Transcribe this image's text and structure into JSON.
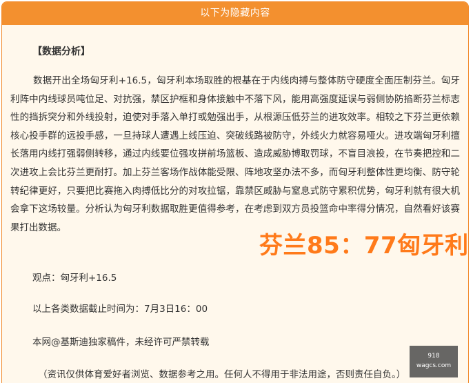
{
  "header": {
    "title": "以下为隐藏内容"
  },
  "article": {
    "section_title": "【数据分析】",
    "analysis_text": "数据开出全场匈牙利+16.5，匈牙利本场取胜的根基在于内线肉搏与整体防守硬度全面压制芬兰。匈牙利阵中内线球员吨位足、对抗强，禁区护框和身体接触中不落下风，能用高强度延误与弱侧协防掐断芬兰标志性的挡拆突分和外线投射，迫使对手落入单打或勉强出手，从根源压低芬兰的进攻效率。相较之下芬兰更依赖核心投手群的远投手感，一旦持球人遭遇上线压迫、突破线路被防守，外线火力就容易哑火。进攻端匈牙利擅长落用内线打强弱侧转移，通过内线要位强攻拼前场篮板、造成威胁博取罚球，不盲目浪投，在节奏把控和二次进攻上会比芬兰更耐打。加上芬兰客场作战体能受限、阵地攻坚办法不多，而匈牙利整体性更均衡、防守轮转纪律更好，只要把比赛拖入肉搏低比分的对攻拉锯，靠禁区威胁与窒息式防守累积优势，匈牙利就有很大机会拿下这场较量。分析认为匈牙利数据取胜更值得参考，在考虑到双方员投篮命中率得分情况，自然看好该赛果打出数据。",
    "opinion": "观点：匈牙利+16.5",
    "deadline": "以上各类数据截止时间为：7月3日16：00",
    "copyright": "本网@基斯迪独家稿件，未经许可严禁转载",
    "disclaimer": "（资讯仅供体育爱好者浏览、数据参考之用。任何人不得用于非法用途，否则责任自负。）",
    "score": "芬兰85：77匈牙利"
  },
  "watermark": {
    "line1": "918",
    "line2": "wagcs.com"
  },
  "colors": {
    "accent": "#f3902f",
    "panel_bg": "#fff8ec",
    "score": "#ff7a1a",
    "text": "#333333"
  }
}
